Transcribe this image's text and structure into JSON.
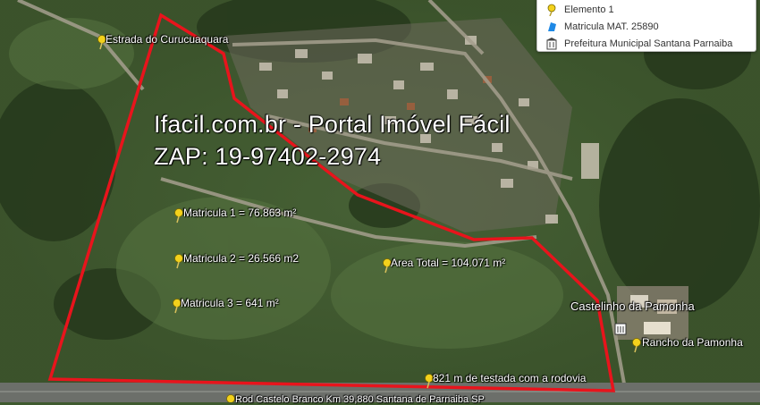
{
  "legend": {
    "items": [
      {
        "icon": "pushpin-icon",
        "label": "Elemento 1"
      },
      {
        "icon": "polygon-icon",
        "label": "Matricula MAT. 25890"
      },
      {
        "icon": "building-icon",
        "label": "Prefeitura Municipal Santana Parnaiba"
      }
    ]
  },
  "overlay": {
    "site_line": "Ifacil.com.br - Portal Imóvel Fácil",
    "phone_line": "ZAP: 19-97402-2974"
  },
  "placemarks": {
    "estrada": "Estrada do Curucuaquara",
    "matricula1": "Matricula 1 =  76.863 m²",
    "matricula2": "Matricula 2 = 26.566 m2",
    "matricula3": "Matricula 3 = 641 m²",
    "area_total": "Area Total = 104.071 m²",
    "testada": "821 m de testada com a rodovia",
    "castelinho": "Castelinho da Pamonha",
    "rancho": "Rancho da Pamonha",
    "rodovia": "Rod Castelo Branco Km 39,880 Santana de Parnaiba SP"
  },
  "colors": {
    "boundary": "#e8141c",
    "pin": "#f3d11c",
    "vegetation": "#3f5a2e",
    "road": "#6c6f6a"
  }
}
